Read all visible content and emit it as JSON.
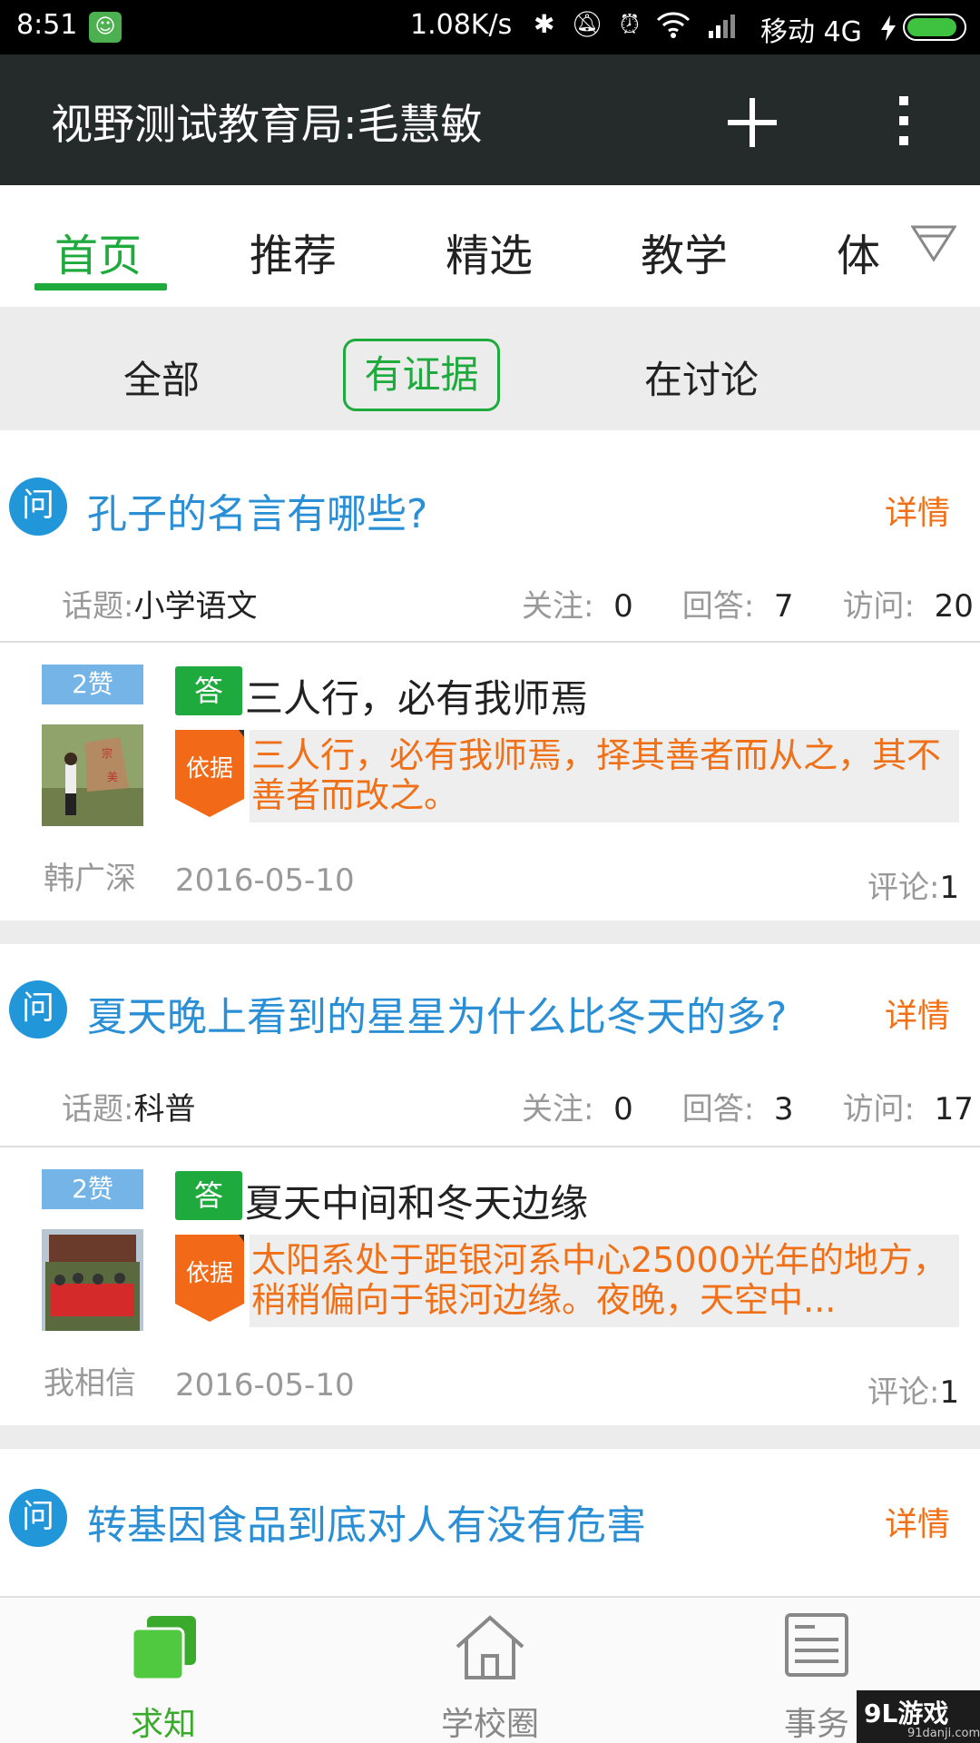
{
  "status_bar": {
    "time": "8:51",
    "net_speed": "1.08K/s",
    "carrier": "移动 4G",
    "icons": [
      "bluetooth-icon",
      "silent-icon",
      "alarm-icon",
      "wifi-icon",
      "signal-icon",
      "charging-icon",
      "battery-icon"
    ],
    "battery_level": 0.9
  },
  "app_bar": {
    "title": "视野测试教育局:毛慧敏"
  },
  "channel_tabs": [
    "首页",
    "推荐",
    "精选",
    "教学",
    "体"
  ],
  "filters": [
    "全部",
    "有证据",
    "在讨论"
  ],
  "labels": {
    "question_badge": "问",
    "detail": "详情",
    "topic": "话题:",
    "follow": "关注:",
    "answers": "回答:",
    "visits": "访问:",
    "answer_tag": "答",
    "evidence_tag": "依据",
    "comments": "评论:"
  },
  "questions": [
    {
      "title": "孔子的名言有哪些?",
      "topic": "小学语文",
      "follow": "0",
      "answers": "7",
      "visits": "20",
      "answer": {
        "likes": "2赞",
        "author": "韩广深",
        "title": "三人行，必有我师焉",
        "evidence": "三人行，必有我师焉，择其善者而从之，其不善者而改之。",
        "date": "2016-05-10",
        "comments": "1"
      }
    },
    {
      "title": "夏天晚上看到的星星为什么比冬天的多?",
      "topic": "科普",
      "follow": "0",
      "answers": "3",
      "visits": "17",
      "answer": {
        "likes": "2赞",
        "author": "我相信",
        "title": "夏天中间和冬天边缘",
        "evidence": "太阳系处于距银河系中心25000光年的地方，稍稍偏向于银河边缘。夜晚，天空中...",
        "date": "2016-05-10",
        "comments": "1"
      }
    },
    {
      "title": "转基因食品到底对人有没有危害"
    }
  ],
  "bottom_nav": [
    "求知",
    "学校圈",
    "事务"
  ],
  "watermark": {
    "main": "9L游戏",
    "sub": "91danji.com"
  },
  "colors": {
    "accent_green": "#1eaa3c",
    "question_blue": "#2196d9",
    "detail_orange": "#f07018",
    "app_bar": "#252a2b"
  }
}
